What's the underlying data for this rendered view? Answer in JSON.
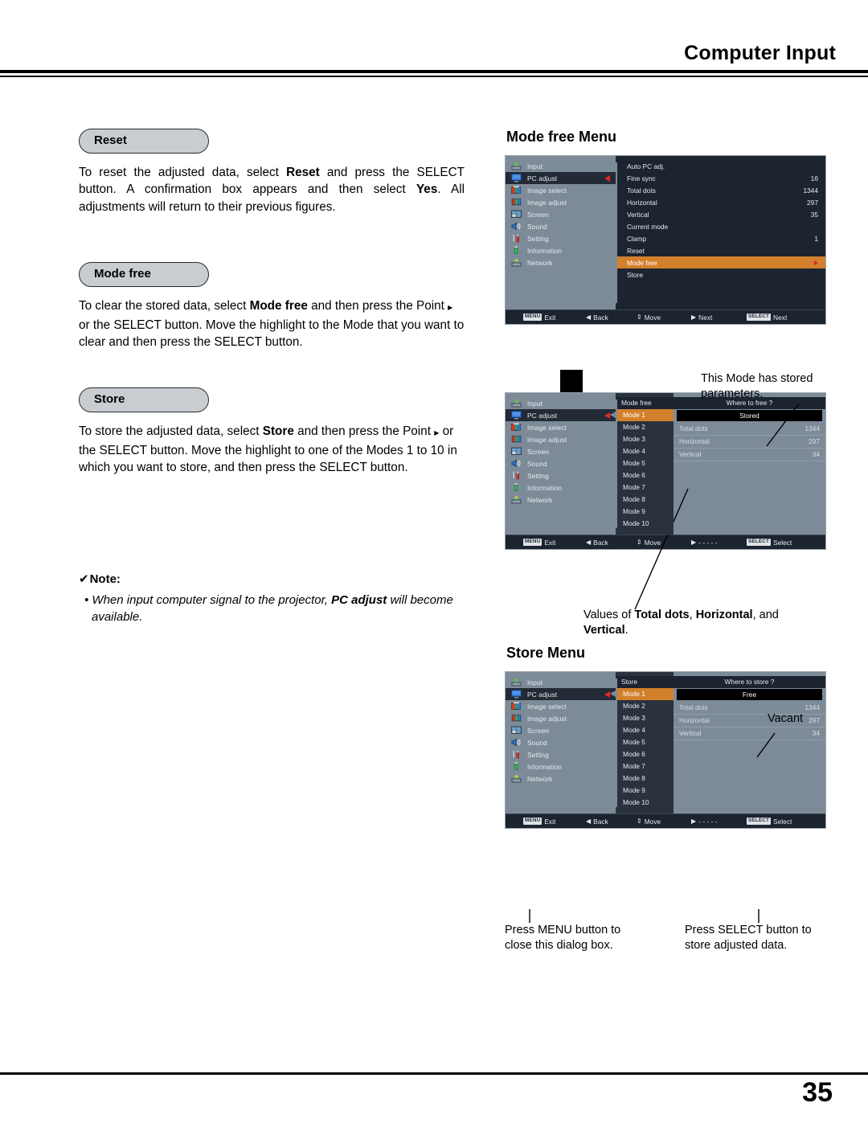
{
  "header": {
    "title": "Computer Input"
  },
  "footer": {
    "page_number": "35"
  },
  "left": {
    "reset": {
      "pill": "Reset",
      "body_1": "To reset the adjusted data, select ",
      "bold_1": "Reset",
      "body_2": " and press the SELECT button. A confirmation box appears and then select ",
      "bold_2": "Yes",
      "body_3": ". All adjustments will return to their previous figures."
    },
    "mode_free": {
      "pill": "Mode free",
      "body_1": "To clear the stored data, select ",
      "bold_1": "Mode free",
      "body_2": " and then press the Point ",
      "glyph": "▶",
      "body_3": " or the SELECT button. Move the highlight to the Mode that you want to clear and then press the SELECT button."
    },
    "store": {
      "pill": "Store",
      "body_1": "To store the adjusted data, select ",
      "bold_1": "Store",
      "body_2": " and then press the Point ",
      "glyph": "▶",
      "body_3": " or the SELECT button. Move the highlight to one of the Modes 1 to 10 in which you want to store, and then press the SELECT button."
    },
    "note": {
      "check": "✔",
      "heading": "Note:",
      "bullet": "•",
      "item_1": " When input computer signal to the projector, ",
      "item_bold": "PC adjust",
      "item_2": " will become available."
    }
  },
  "right": {
    "mode_free_menu": {
      "title": "Mode free Menu",
      "sidebar": [
        {
          "label": "Input",
          "icon": "input-icon"
        },
        {
          "label": "PC adjust",
          "icon": "monitor-icon"
        },
        {
          "label": "Image select",
          "icon": "image-select-icon"
        },
        {
          "label": "Image adjust",
          "icon": "image-adjust-icon"
        },
        {
          "label": "Screen",
          "icon": "screen-icon"
        },
        {
          "label": "Sound",
          "icon": "speaker-icon"
        },
        {
          "label": "Setting",
          "icon": "tools-icon"
        },
        {
          "label": "Information",
          "icon": "info-icon"
        },
        {
          "label": "Network",
          "icon": "network-icon"
        }
      ],
      "active_sidebar": "PC adjust",
      "options": [
        {
          "label": "Auto PC adj.",
          "value": ""
        },
        {
          "label": "Fine sync",
          "value": "16"
        },
        {
          "label": "Total dots",
          "value": "1344"
        },
        {
          "label": "Horizontal",
          "value": "297"
        },
        {
          "label": "Vertical",
          "value": "35"
        },
        {
          "label": "Current mode",
          "value": ""
        },
        {
          "label": "Clamp",
          "value": "1"
        },
        {
          "label": "Reset",
          "value": ""
        },
        {
          "label": "Mode free",
          "value": "",
          "highlighted": true
        },
        {
          "label": "Store",
          "value": ""
        }
      ],
      "footer_hints": [
        {
          "key": "MENU",
          "label": "Exit"
        },
        {
          "glyph": "◀",
          "label": "Back"
        },
        {
          "glyph": "⇕",
          "label": "Move"
        },
        {
          "glyph": "▶",
          "label": "Next"
        },
        {
          "key": "SELECT",
          "label": "Next"
        }
      ]
    },
    "mode_free_select": {
      "sidebar": [
        {
          "label": "Input",
          "icon": "input-icon"
        },
        {
          "label": "PC adjust",
          "icon": "monitor-icon"
        },
        {
          "label": "Image select",
          "icon": "image-select-icon"
        },
        {
          "label": "Image adjust",
          "icon": "image-adjust-icon"
        },
        {
          "label": "Screen",
          "icon": "screen-icon"
        },
        {
          "label": "Sound",
          "icon": "speaker-icon"
        },
        {
          "label": "Setting",
          "icon": "tools-icon"
        },
        {
          "label": "Information",
          "icon": "info-icon"
        },
        {
          "label": "Network",
          "icon": "network-icon"
        }
      ],
      "active_sidebar": "PC adjust",
      "list_title": "Mode free",
      "pane_title": "Where to free ?",
      "modes": [
        "Mode 1",
        "Mode 2",
        "Mode 3",
        "Mode 4",
        "Mode 5",
        "Mode 6",
        "Mode 7",
        "Mode 8",
        "Mode 9",
        "Mode 10"
      ],
      "selected_mode": "Mode 1",
      "status": "Stored",
      "values": [
        {
          "label": "Total dots",
          "value": "1344"
        },
        {
          "label": "Horizontal",
          "value": "297"
        },
        {
          "label": "Vertical",
          "value": "34"
        }
      ],
      "footer_hints": [
        {
          "key": "MENU",
          "label": "Exit"
        },
        {
          "glyph": "◀",
          "label": "Back"
        },
        {
          "glyph": "⇕",
          "label": "Move"
        },
        {
          "glyph": "▶",
          "label": "- - - - -"
        },
        {
          "key": "SELECT",
          "label": "Select"
        }
      ]
    },
    "store_menu": {
      "title": "Store Menu",
      "sidebar": [
        {
          "label": "Input",
          "icon": "input-icon"
        },
        {
          "label": "PC adjust",
          "icon": "monitor-icon"
        },
        {
          "label": "Image select",
          "icon": "image-select-icon"
        },
        {
          "label": "Image adjust",
          "icon": "image-adjust-icon"
        },
        {
          "label": "Screen",
          "icon": "screen-icon"
        },
        {
          "label": "Sound",
          "icon": "speaker-icon"
        },
        {
          "label": "Setting",
          "icon": "tools-icon"
        },
        {
          "label": "Information",
          "icon": "info-icon"
        },
        {
          "label": "Network",
          "icon": "network-icon"
        }
      ],
      "active_sidebar": "PC adjust",
      "list_title": "Store",
      "pane_title": "Where to store ?",
      "modes": [
        "Mode 1",
        "Mode 2",
        "Mode 3",
        "Mode 4",
        "Mode 5",
        "Mode 6",
        "Mode 7",
        "Mode 8",
        "Mode 9",
        "Mode 10"
      ],
      "selected_mode": "Mode 1",
      "status": "Free",
      "values": [
        {
          "label": "Total dots",
          "value": "1344"
        },
        {
          "label": "Horizontal",
          "value": "297"
        },
        {
          "label": "Vertical",
          "value": "34"
        }
      ],
      "footer_hints": [
        {
          "key": "MENU",
          "label": "Exit"
        },
        {
          "glyph": "◀",
          "label": "Back"
        },
        {
          "glyph": "⇕",
          "label": "Move"
        },
        {
          "glyph": "▶",
          "label": "- - - - -"
        },
        {
          "key": "SELECT",
          "label": "Select"
        }
      ]
    },
    "callouts": {
      "stored_note": "This Mode has stored parameters.",
      "values_note_1": "Values of ",
      "values_note_b1": "Total dots",
      "values_note_2": ", ",
      "values_note_b2": "Horizontal",
      "values_note_3": ", and ",
      "values_note_b3": "Vertical",
      "values_note_4": ".",
      "vacant": "Vacant",
      "menu_note": "Press MENU button to close this dialog box.",
      "select_note": "Press SELECT button to store adjusted data."
    }
  },
  "colors": {
    "osd_sidebar": "#7d8b99",
    "osd_panel": "#1c2430",
    "highlight_orange": "#d2802c",
    "caret_red": "#e8232a",
    "pill_fill": "#c9cdd1"
  }
}
